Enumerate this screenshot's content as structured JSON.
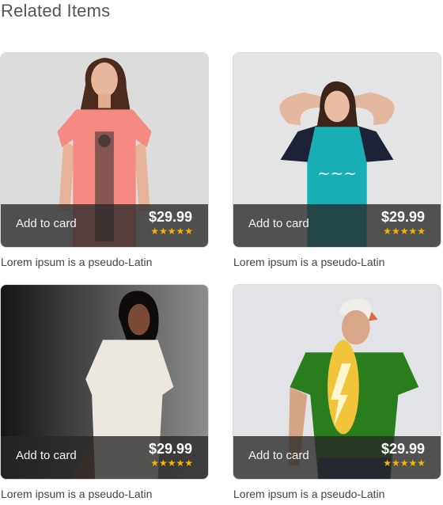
{
  "section": {
    "title": "Related Items"
  },
  "accent": {
    "star_color": "#f7b500",
    "overlay_color": "#282828"
  },
  "products": [
    {
      "image": "woman-pink-tshirt",
      "add_label": "Add to card",
      "price": "$29.99",
      "rating_stars": "★★★★★",
      "rating": 5,
      "caption": "Lorem ipsum is a pseudo-Latin"
    },
    {
      "image": "woman-teal-tshirt",
      "add_label": "Add to card",
      "price": "$29.99",
      "rating_stars": "★★★★★",
      "rating": 5,
      "caption": "Lorem ipsum is a pseudo-Latin"
    },
    {
      "image": "woman-white-knit-dress",
      "add_label": "Add to card",
      "price": "$29.99",
      "rating_stars": "★★★★★",
      "rating": 5,
      "caption": "Lorem ipsum is a pseudo-Latin"
    },
    {
      "image": "man-green-tshirt",
      "add_label": "Add to card",
      "price": "$29.99",
      "rating_stars": "★★★★★",
      "rating": 5,
      "caption": "Lorem ipsum is a pseudo-Latin"
    }
  ]
}
